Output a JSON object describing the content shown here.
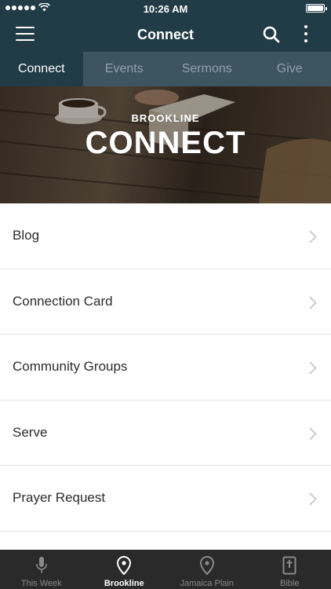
{
  "status_bar": {
    "time": "10:26 AM"
  },
  "nav": {
    "title": "Connect"
  },
  "tabs": [
    {
      "label": "Connect",
      "active": true
    },
    {
      "label": "Events",
      "active": false
    },
    {
      "label": "Sermons",
      "active": false
    },
    {
      "label": "Give",
      "active": false
    }
  ],
  "hero": {
    "subtitle": "BROOKLINE",
    "title": "CONNECT"
  },
  "list": [
    {
      "label": "Blog"
    },
    {
      "label": "Connection Card"
    },
    {
      "label": "Community Groups"
    },
    {
      "label": "Serve"
    },
    {
      "label": "Prayer Request"
    }
  ],
  "bottom_tabs": [
    {
      "label": "This Week",
      "icon": "microphone-icon",
      "active": false
    },
    {
      "label": "Brookline",
      "icon": "map-pin-icon",
      "active": true
    },
    {
      "label": "Jamaica Plain",
      "icon": "map-pin-icon",
      "active": false
    },
    {
      "label": "Bible",
      "icon": "bible-icon",
      "active": false
    }
  ],
  "colors": {
    "nav_bg": "#213b47",
    "tabs_bg": "#3d5560",
    "bottom_bg": "#2a2a2a"
  }
}
